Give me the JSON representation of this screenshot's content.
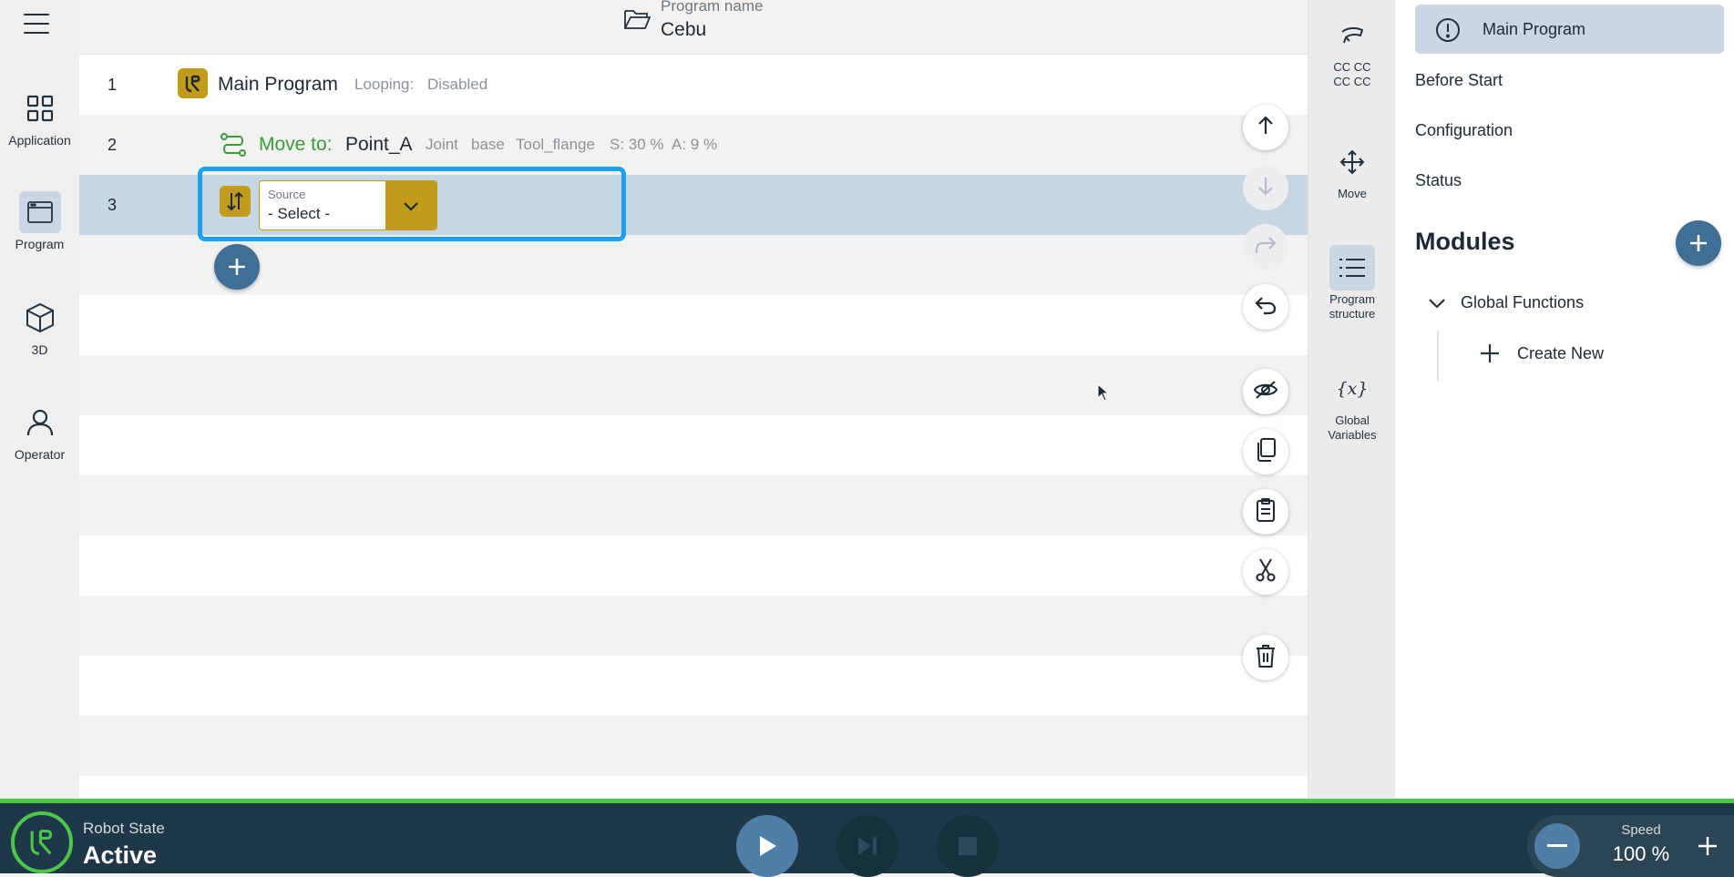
{
  "left_nav": {
    "menu_icon": "hamburger-menu-icon",
    "items": [
      {
        "label": "Application",
        "icon": "grid-icon",
        "active": false
      },
      {
        "label": "Program",
        "icon": "program-window-icon",
        "active": true
      },
      {
        "label": "3D",
        "icon": "cube-icon",
        "active": false
      },
      {
        "label": "Operator",
        "icon": "person-icon",
        "active": false
      }
    ]
  },
  "header": {
    "program_name_label": "Program name",
    "program_name": "Cebu",
    "icon": "folder-open-icon"
  },
  "tree": {
    "rows": [
      {
        "number": "1",
        "title": "Main Program",
        "looping_label": "Looping:",
        "looping_value": "Disabled"
      },
      {
        "number": "2",
        "move_label": "Move to:",
        "point": "Point_A",
        "params": [
          "Joint",
          "base",
          "Tool_flange",
          "S: 30 %",
          "A: 9 %"
        ]
      },
      {
        "number": "3",
        "source_label": "Source",
        "source_value": "- Select -"
      }
    ],
    "tools": [
      {
        "name": "move-up",
        "icon": "arrow-up-icon",
        "enabled": true
      },
      {
        "name": "move-down",
        "icon": "arrow-down-icon",
        "enabled": false
      },
      {
        "name": "redo",
        "icon": "redo-icon",
        "enabled": false
      },
      {
        "name": "undo",
        "icon": "undo-icon",
        "enabled": true
      },
      {
        "name": "suppress",
        "icon": "eye-off-icon",
        "enabled": true
      },
      {
        "name": "copy",
        "icon": "copy-icon",
        "enabled": true
      },
      {
        "name": "paste",
        "icon": "clipboard-icon",
        "enabled": true
      },
      {
        "name": "cut",
        "icon": "scissors-icon",
        "enabled": true
      },
      {
        "name": "delete",
        "icon": "trash-icon",
        "enabled": true
      }
    ]
  },
  "strip": {
    "items": [
      {
        "label_line1": "CC CC",
        "label_line2": "CC CC",
        "icon": "gripper-icon",
        "active": false
      },
      {
        "label_line1": "Move",
        "label_line2": "",
        "icon": "move-arrows-icon",
        "active": false
      },
      {
        "label_line1": "Program",
        "label_line2": "structure",
        "icon": "list-icon",
        "active": true
      },
      {
        "label_line1": "Global",
        "label_line2": "Variables",
        "icon": "variable-x-icon",
        "active": false
      }
    ]
  },
  "right_panel": {
    "main_program": "Main Program",
    "main_program_icon": "alert-circle-icon",
    "items": [
      "Before Start",
      "Configuration",
      "Status"
    ],
    "modules_title": "Modules",
    "global_functions": "Global Functions",
    "create_new": "Create New"
  },
  "bottom_bar": {
    "robot_state_label": "Robot State",
    "robot_state_value": "Active",
    "speed_label": "Speed",
    "speed_value": "100 %",
    "accent_color": "#4bc74a"
  }
}
